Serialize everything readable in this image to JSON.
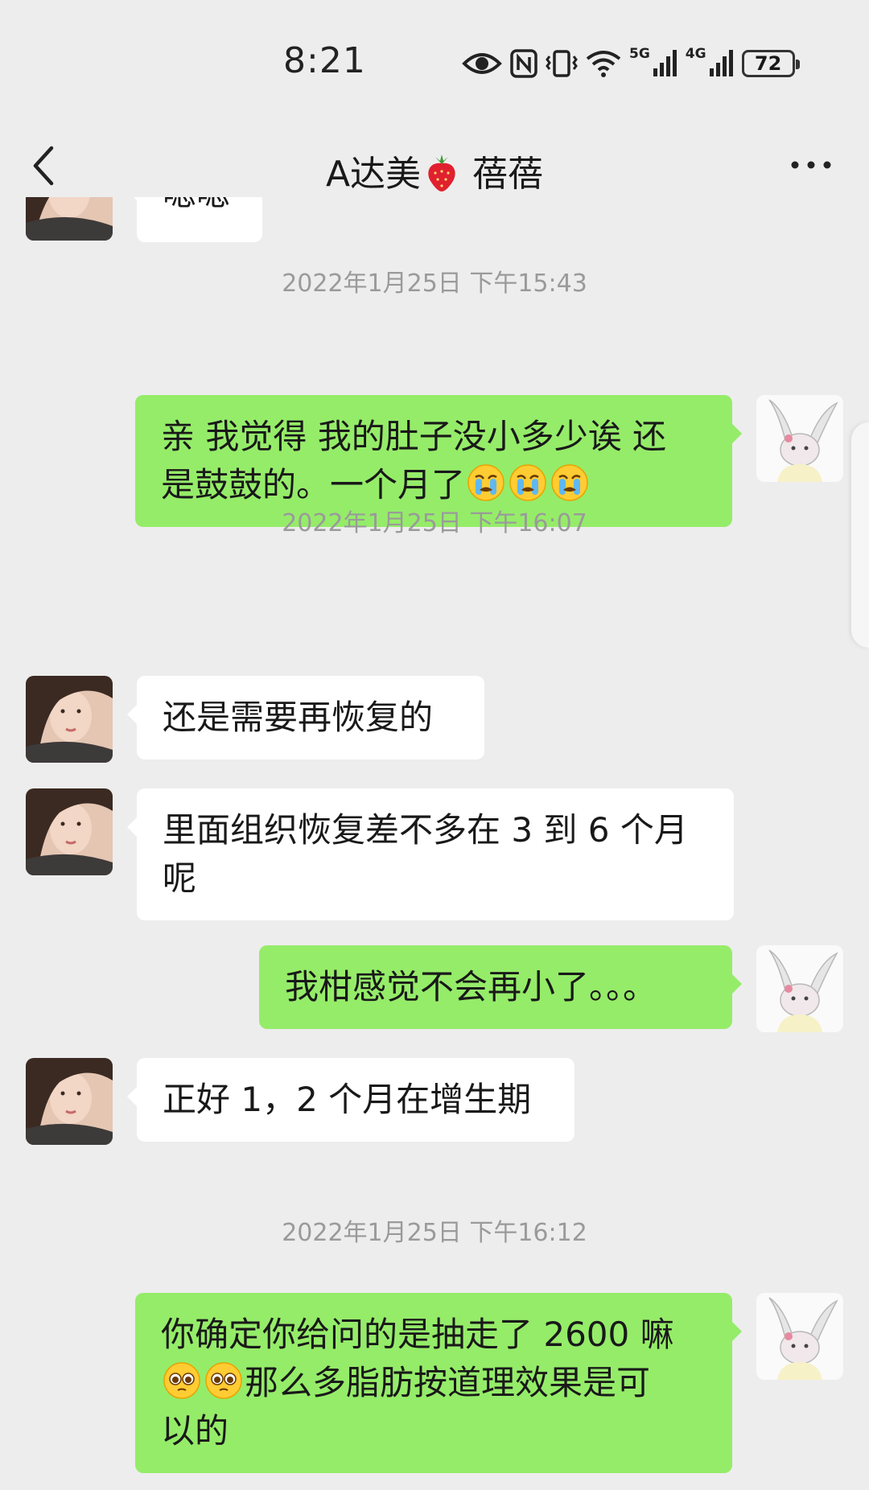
{
  "status_bar": {
    "time": "8:21",
    "signal_1_label": "5G",
    "signal_2_label": "4G",
    "battery": "72"
  },
  "nav": {
    "title_prefix": "A达美",
    "title_suffix": "蓓蓓"
  },
  "timestamps": [
    "2022年1月25日 下午15:43",
    "2022年1月25日 下午16:07",
    "2022年1月25日 下午16:12"
  ],
  "messages": {
    "m0": "嗯嗯",
    "m1a": "亲 我觉得 我的肚子没小多少诶 还",
    "m1b": "是鼓鼓的。一个月了",
    "m2": "还是需要再恢复的",
    "m3a": "里面组织恢复差不多在 3 到 6 个月",
    "m3b": "呢",
    "m4": "我柑感觉不会再小了。。。",
    "m5": "正好 1，2 个月在增生期",
    "m6a": "你确定你给问的是抽走了 2600 嘛",
    "m6b": "那么多脂肪按道理效果是可",
    "m6c": "以的"
  },
  "icons": {
    "crying": "loudly-crying-face-emoji",
    "pleading": "pleading-face-emoji",
    "title": "strawberry-emoji"
  },
  "colors": {
    "background": "#ededed",
    "outgoing_bubble": "#95ec69",
    "incoming_bubble": "#ffffff",
    "timestamp_text": "#9a9a9a"
  }
}
